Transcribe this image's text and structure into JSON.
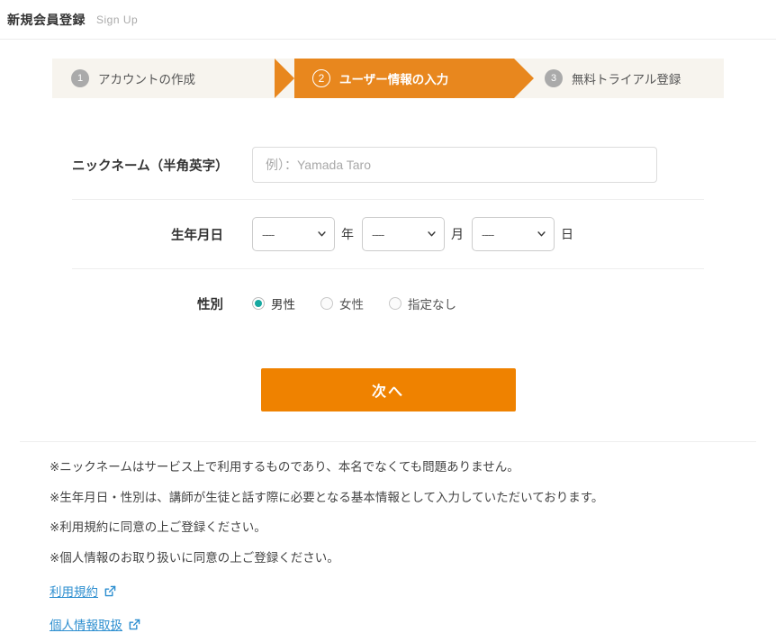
{
  "header": {
    "title": "新規会員登録",
    "subtitle": "Sign Up"
  },
  "stepper": {
    "steps": [
      {
        "number": "1",
        "label": "アカウントの作成",
        "state": "done"
      },
      {
        "number": "2",
        "label": "ユーザー情報の入力",
        "state": "active"
      },
      {
        "number": "3",
        "label": "無料トライアル登録",
        "state": "todo"
      }
    ],
    "active_color": "#e8871e",
    "track_color": "#f7f4ee"
  },
  "form": {
    "nickname": {
      "label": "ニックネーム（半角英字）",
      "value": "",
      "placeholder": "例）：Yamada Taro"
    },
    "birthdate": {
      "label": "生年月日",
      "year": {
        "value": "----",
        "suffix": "年"
      },
      "month": {
        "value": "----",
        "suffix": "月"
      },
      "day": {
        "value": "----",
        "suffix": "日"
      }
    },
    "gender": {
      "label": "性別",
      "options": [
        {
          "label": "男性",
          "selected": true
        },
        {
          "label": "女性",
          "selected": false
        },
        {
          "label": "指定なし",
          "selected": false
        }
      ],
      "selected_color": "#16a8a0"
    },
    "submit_label": "次へ"
  },
  "notes": [
    "※ニックネームはサービス上で利用するものであり、本名でなくても問題ありません。",
    "※生年月日・性別は、講師が生徒と話す際に必要となる基本情報として入力していただいております。",
    "※利用規約に同意の上ご登録ください。",
    "※個人情報のお取り扱いに同意の上ご登録ください。"
  ],
  "links": [
    {
      "label": "利用規約",
      "icon": "external-link-icon"
    },
    {
      "label": "個人情報取扱",
      "icon": "external-link-icon"
    }
  ],
  "colors": {
    "accent_orange": "#ef8200",
    "link_blue": "#2e8fd0"
  }
}
